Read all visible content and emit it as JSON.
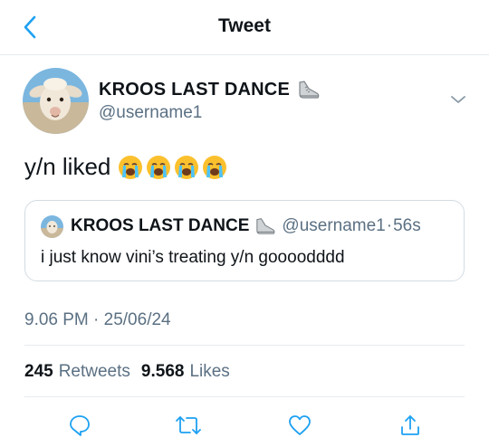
{
  "header": {
    "title": "Tweet",
    "back_icon": "chevron-left-icon"
  },
  "colors": {
    "accent": "#1da1f2",
    "text": "#0f1419",
    "secondary": "#5b7083",
    "border": "#e6ecf0"
  },
  "tweet": {
    "author_name": "KROOS LAST DANCE",
    "author_handle": "@username1",
    "text": "y/n liked",
    "emojis": [
      "crying-face",
      "crying-face",
      "crying-face",
      "crying-face"
    ],
    "timestamp": "9.06 PM · 25/06/24"
  },
  "quote": {
    "author_name": "KROOS LAST DANCE",
    "author_handle": "@username1",
    "separator": "·",
    "time": "56s",
    "text": "i just know vini’s treating y/n goooodddd"
  },
  "stats": {
    "retweets_count": "245",
    "retweets_label": "Retweets",
    "likes_count": "9.568",
    "likes_label": "Likes"
  },
  "actions": [
    "reply-icon",
    "retweet-icon",
    "like-icon",
    "share-icon"
  ]
}
